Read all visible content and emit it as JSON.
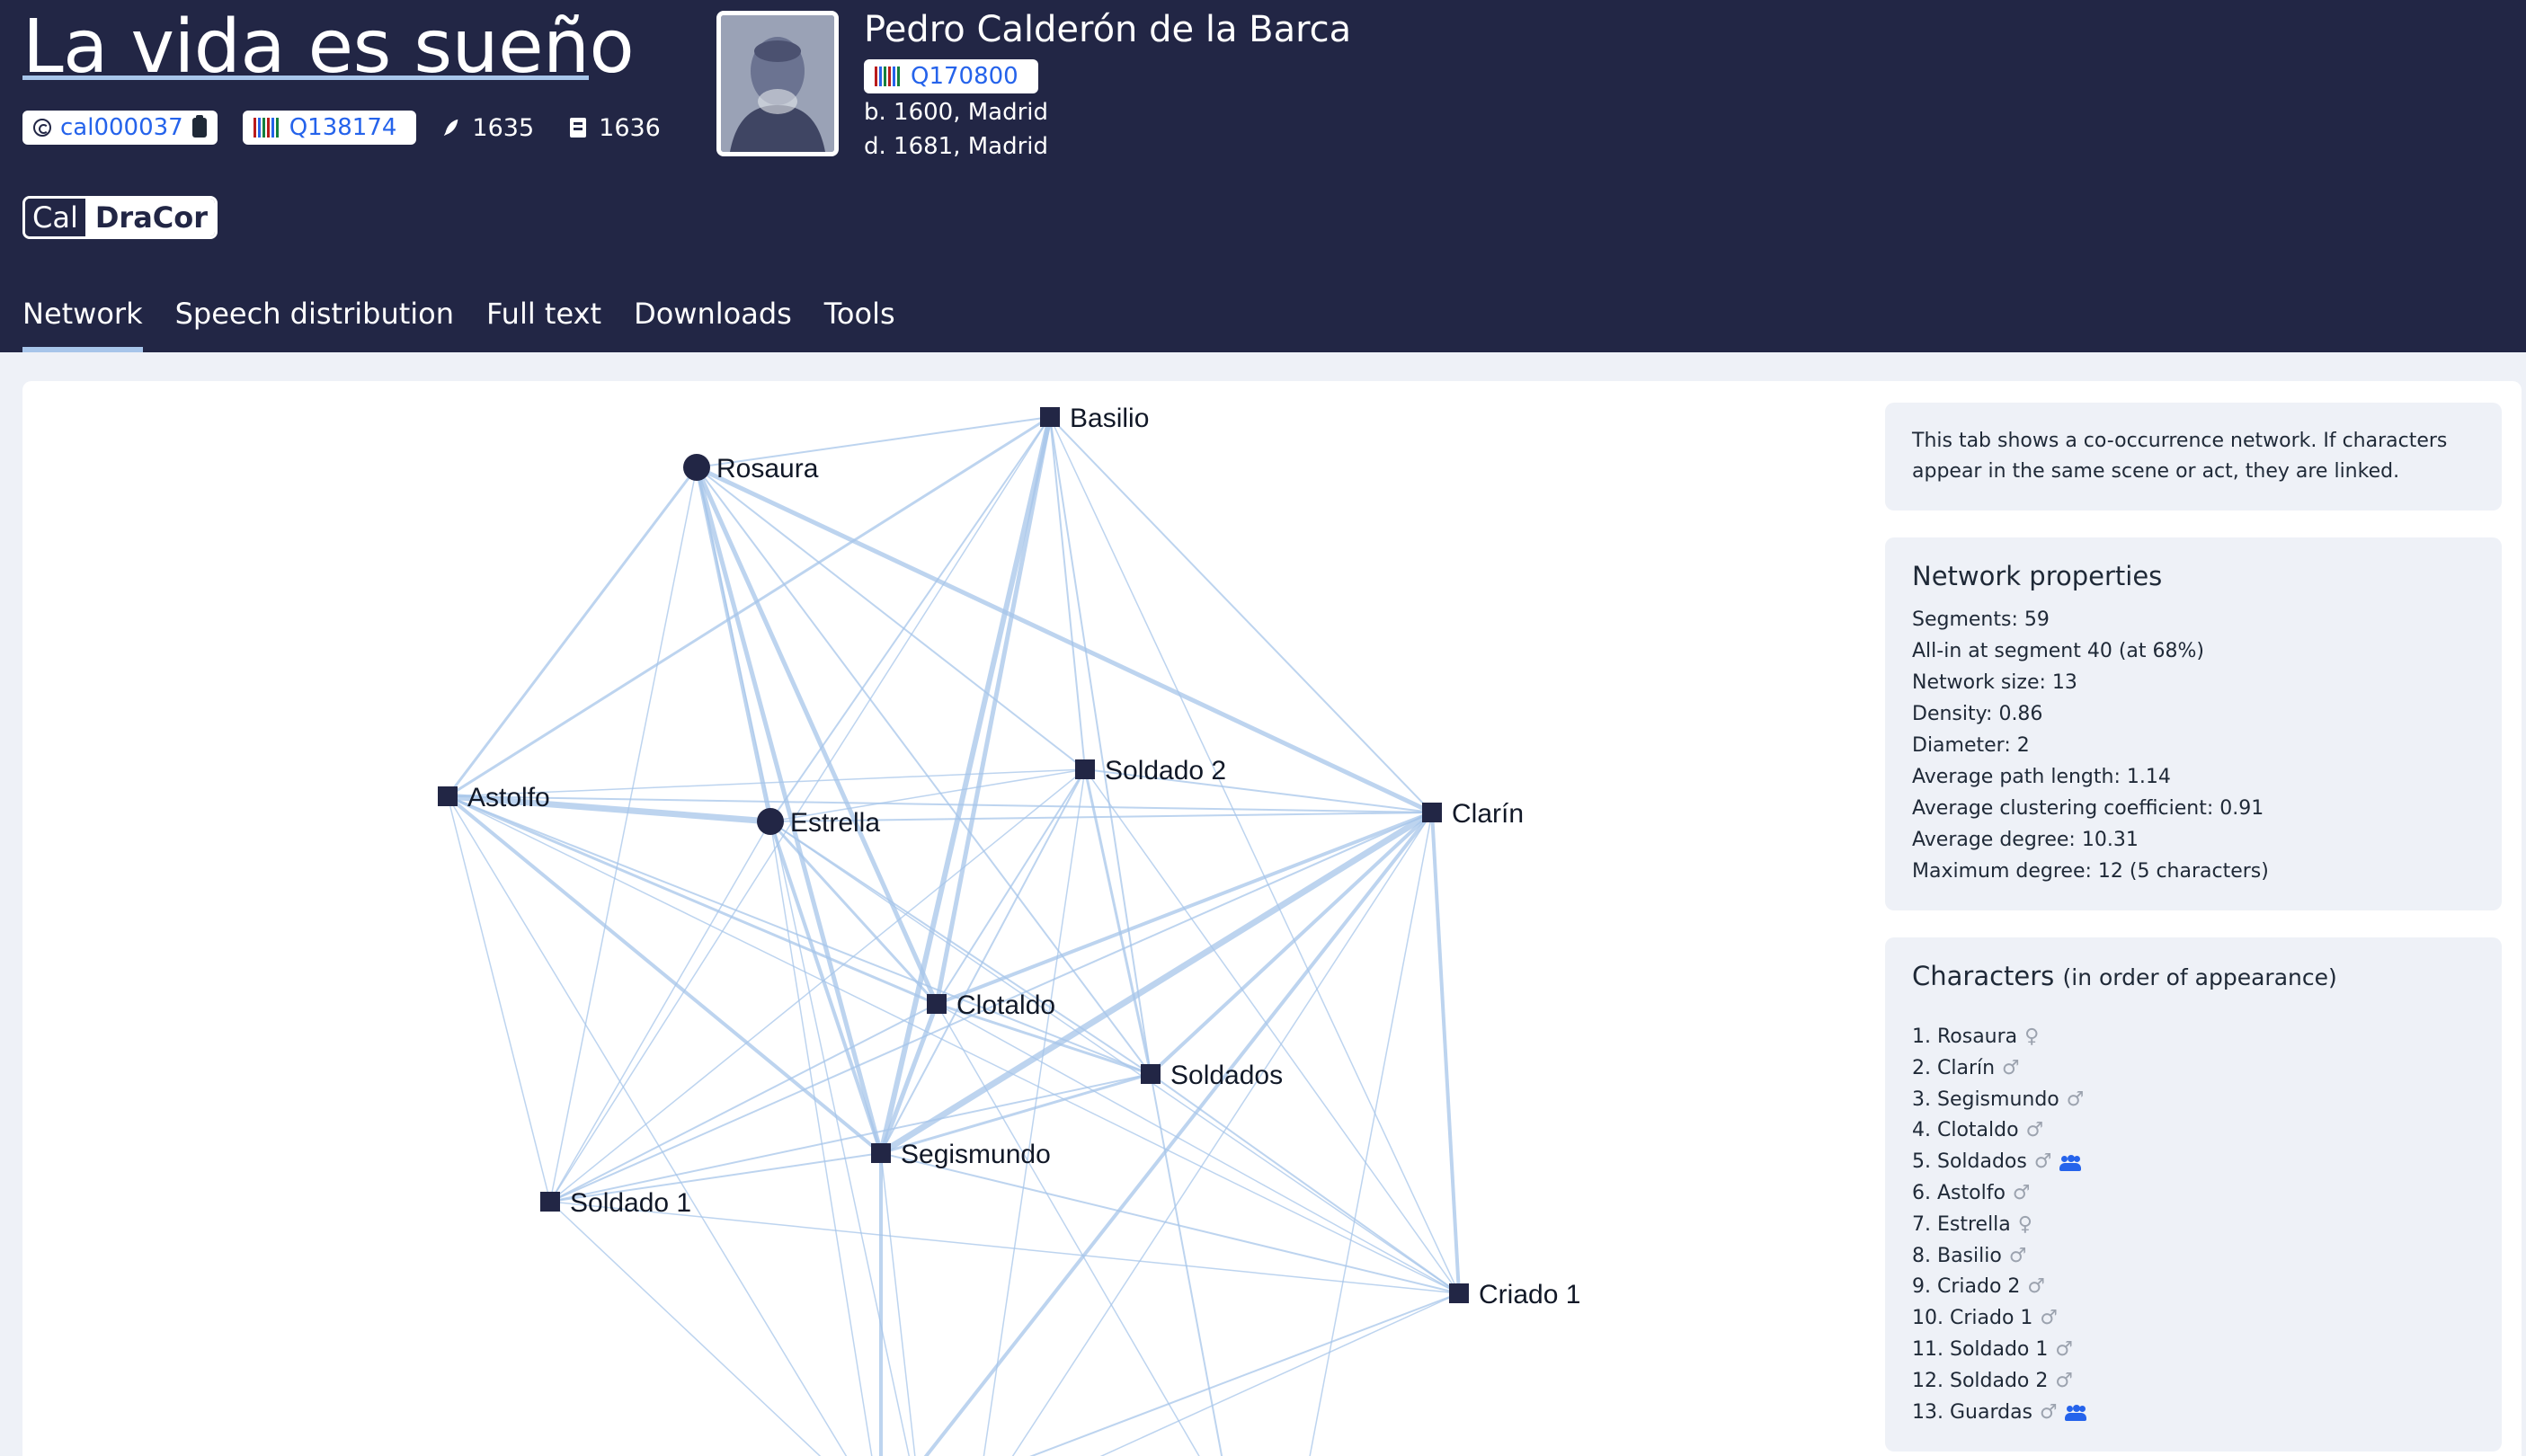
{
  "play": {
    "title": "La vida es sueño",
    "id": "cal000037",
    "wikidata": "Q138174",
    "written": "1635",
    "printed": "1636"
  },
  "author": {
    "name": "Pedro Calderón de la Barca",
    "wikidata": "Q170800",
    "born": "b. 1600, Madrid",
    "died": "d. 1681, Madrid"
  },
  "corpus": {
    "logo_left": "Cal",
    "logo_right": "DraCor"
  },
  "tabs": [
    {
      "label": "Network",
      "active": true
    },
    {
      "label": "Speech distribution"
    },
    {
      "label": "Full text"
    },
    {
      "label": "Downloads"
    },
    {
      "label": "Tools"
    }
  ],
  "info": "This tab shows a co-occurrence network. If characters appear in the same scene or act, they are linked.",
  "properties": {
    "title": "Network properties",
    "lines": [
      "Segments: 59",
      "All-in at segment 40 (at 68%)",
      "Network size: 13",
      "Density: 0.86",
      "Diameter: 2",
      "Average path length: 1.14",
      "Average clustering coefficient: 0.91",
      "Average degree: 10.31",
      "Maximum degree: 12 (5 characters)"
    ]
  },
  "characters": {
    "title": "Characters",
    "subtitle": "(in order of appearance)",
    "items": [
      {
        "label": "1. Rosaura",
        "gender": "female"
      },
      {
        "label": "2. Clarín",
        "gender": "male"
      },
      {
        "label": "3. Segismundo",
        "gender": "male"
      },
      {
        "label": "4. Clotaldo",
        "gender": "male"
      },
      {
        "label": "5. Soldados",
        "gender": "male",
        "group": true
      },
      {
        "label": "6. Astolfo",
        "gender": "male"
      },
      {
        "label": "7. Estrella",
        "gender": "female"
      },
      {
        "label": "8. Basilio",
        "gender": "male"
      },
      {
        "label": "9. Criado 2",
        "gender": "male"
      },
      {
        "label": "10. Criado 1",
        "gender": "male"
      },
      {
        "label": "11. Soldado 1",
        "gender": "male"
      },
      {
        "label": "12. Soldado 2",
        "gender": "male"
      },
      {
        "label": "13. Guardas",
        "gender": "male",
        "group": true
      }
    ]
  },
  "network": {
    "nodes": [
      {
        "label": "Basilio",
        "shape": "square"
      },
      {
        "label": "Rosaura",
        "shape": "circle"
      },
      {
        "label": "Astolfo",
        "shape": "square"
      },
      {
        "label": "Estrella",
        "shape": "circle"
      },
      {
        "label": "Soldado 2",
        "shape": "square"
      },
      {
        "label": "Clarín",
        "shape": "square"
      },
      {
        "label": "Clotaldo",
        "shape": "square"
      },
      {
        "label": "Soldados",
        "shape": "square"
      },
      {
        "label": "Segismundo",
        "shape": "square"
      },
      {
        "label": "Soldado 1",
        "shape": "square"
      },
      {
        "label": "Criado 1",
        "shape": "square"
      }
    ],
    "edge_color": "#a7c5ea",
    "node_color": "#222645"
  }
}
